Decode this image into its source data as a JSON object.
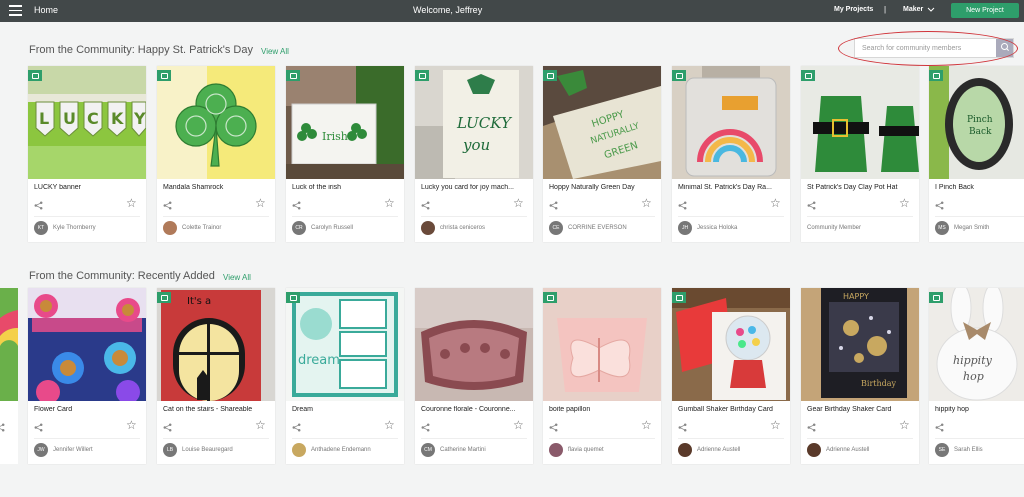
{
  "topbar": {
    "home": "Home",
    "welcome": "Welcome, Jeffrey",
    "my_projects": "My Projects",
    "separator": "|",
    "maker": "Maker",
    "new_project": "New Project"
  },
  "search": {
    "placeholder": "Search for community members"
  },
  "sections": [
    {
      "title": "From the Community: Happy St. Patrick's Day",
      "view_all": "View All",
      "cards": [
        {
          "title": "LUCKY banner",
          "initials": "KT",
          "user": "Kyle Thornberry"
        },
        {
          "title": "Mandala Shamrock",
          "initials": "",
          "user": "Colette Trainor"
        },
        {
          "title": "Luck of the irish",
          "initials": "CR",
          "user": "Carolyn Russell"
        },
        {
          "title": "Lucky you card for joy mach...",
          "initials": "",
          "user": "christa ceniceros"
        },
        {
          "title": "Hoppy Naturally Green Day",
          "initials": "CE",
          "user": "CORRINE EVERSON"
        },
        {
          "title": "Minimal St. Patrick's Day Ra...",
          "initials": "JH",
          "user": "Jessica Holoka"
        },
        {
          "title": "St Patrick's Day Clay Pot Hat",
          "initials": "",
          "user": "Community Member"
        },
        {
          "title": "I Pinch Back",
          "initials": "MS",
          "user": "Megan Smith"
        }
      ]
    },
    {
      "title": "From the Community: Recently Added",
      "view_all": "View All",
      "cards": [
        {
          "title": "Flower Card",
          "initials": "JW",
          "user": "Jennifer Willert"
        },
        {
          "title": "Cat on the stairs - Shareable",
          "initials": "LB",
          "user": "Louise Beauregard"
        },
        {
          "title": "Dream",
          "initials": "",
          "user": "Anthadene Endemann"
        },
        {
          "title": "Couronne florale - Couronne...",
          "initials": "CM",
          "user": "Catherine Martini"
        },
        {
          "title": "boite papillon",
          "initials": "",
          "user": "flavia quemet"
        },
        {
          "title": "Gumball Shaker Birthday Card",
          "initials": "",
          "user": "Adrienne Austell"
        },
        {
          "title": "Gear Birthday Shaker Card",
          "initials": "",
          "user": "Adrienne Austell"
        },
        {
          "title": "hippity hop",
          "initials": "SE",
          "user": "Sarah Ellis"
        }
      ]
    }
  ],
  "colors": {
    "accent": "#2e9e6b",
    "topbar": "#424849",
    "annotation": "#d0343a"
  }
}
